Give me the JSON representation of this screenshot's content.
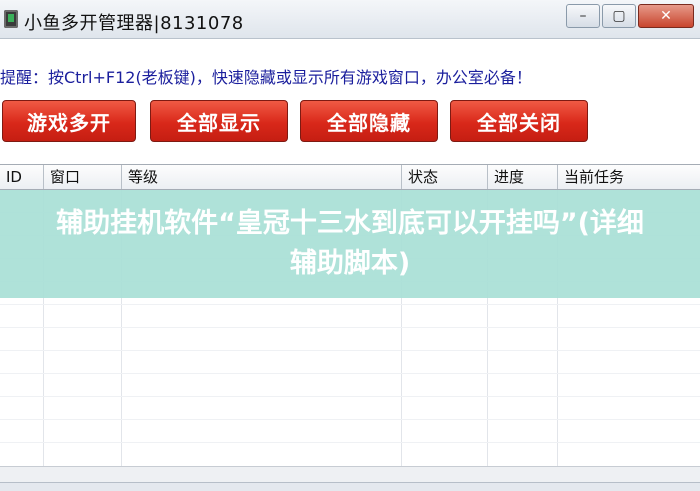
{
  "window": {
    "title": "小鱼多开管理器|8131078",
    "controls": {
      "minimize": "–",
      "restore": "▢",
      "close": "✕"
    }
  },
  "tip": "提醒：按Ctrl+F12(老板键)，快速隐藏或显示所有游戏窗口，办公室必备！",
  "buttons": {
    "multi_open": "游戏多开",
    "show_all": "全部显示",
    "hide_all": "全部隐藏",
    "close_all": "全部关闭"
  },
  "table": {
    "headers": [
      "ID",
      "窗口",
      "等级",
      "状态",
      "进度",
      "当前任务"
    ]
  },
  "overlay": {
    "text": "辅助挂机软件“皇冠十三水到底可以开挂吗”(详细辅助脚本)"
  },
  "colors": {
    "button_red": "#d9281a",
    "tip_blue": "#1b1f9d",
    "overlay_teal": "#a8dfd6"
  }
}
